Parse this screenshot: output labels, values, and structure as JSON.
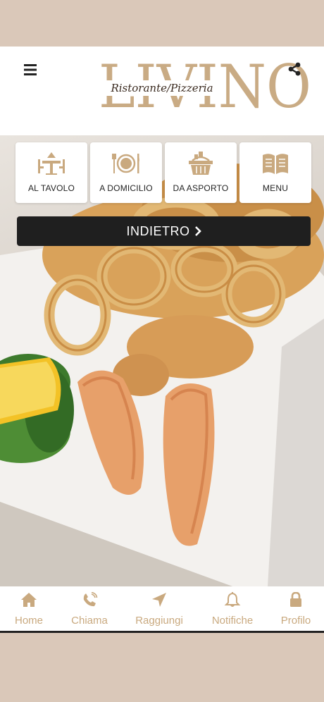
{
  "colors": {
    "accent": "#c9a97f",
    "logo": "#c9ab84",
    "dark_button": "#1f1f1f",
    "band": "#dac8b9"
  },
  "header": {
    "logo_wordmark": "LIVINO",
    "logo_subtitle": "Ristorante/Pizzeria",
    "menu_icon": "hamburger-icon",
    "share_icon": "share-icon"
  },
  "tiles": [
    {
      "label": "AL TAVOLO",
      "icon": "table-dining-icon"
    },
    {
      "label": "A DOMICILIO",
      "icon": "plate-cutlery-icon"
    },
    {
      "label": "DA ASPORTO",
      "icon": "basket-icon"
    },
    {
      "label": "MENU",
      "icon": "open-book-icon"
    }
  ],
  "back_button": {
    "label": "INDIETRO"
  },
  "bottom_nav": [
    {
      "label": "Home",
      "icon": "home-icon"
    },
    {
      "label": "Chiama",
      "icon": "phone-icon"
    },
    {
      "label": "Raggiungi",
      "icon": "location-arrow-icon"
    },
    {
      "label": "Notifiche",
      "icon": "bell-icon"
    },
    {
      "label": "Profilo",
      "icon": "lock-icon"
    }
  ]
}
